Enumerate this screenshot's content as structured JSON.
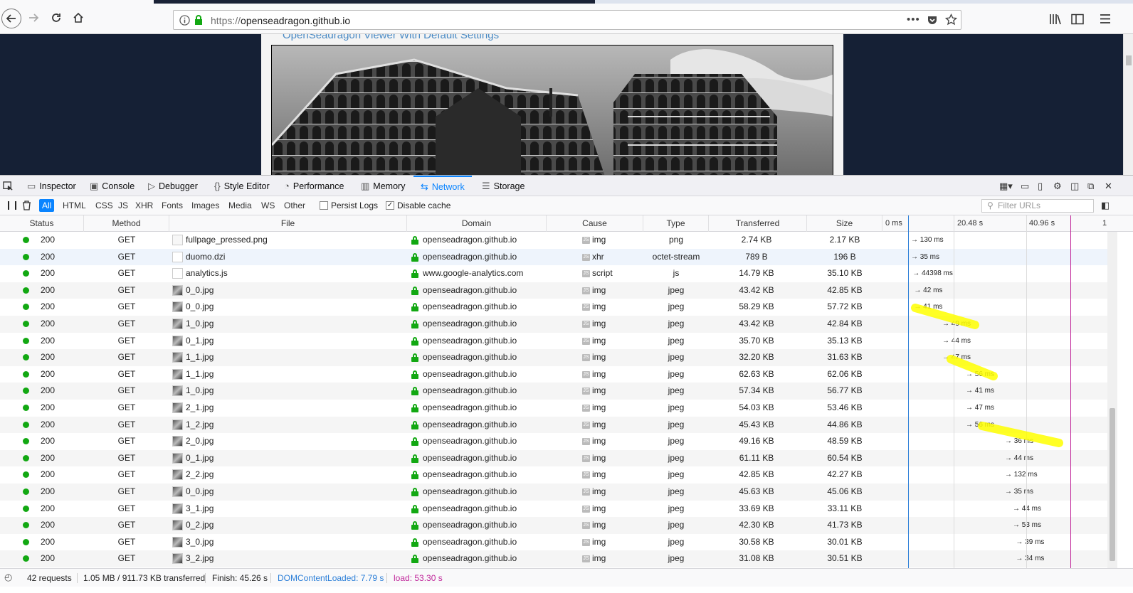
{
  "browser": {
    "url_scheme": "https://",
    "url_host": "openseadragon.github.io"
  },
  "page": {
    "title": "OpenSeadragon Viewer With Default Settings"
  },
  "devtools": {
    "tabs": [
      {
        "label": "Inspector",
        "icon": "inspector-icon"
      },
      {
        "label": "Console",
        "icon": "console-icon"
      },
      {
        "label": "Debugger",
        "icon": "debugger-icon"
      },
      {
        "label": "Style Editor",
        "icon": "style-editor-icon"
      },
      {
        "label": "Performance",
        "icon": "performance-icon"
      },
      {
        "label": "Memory",
        "icon": "memory-icon"
      },
      {
        "label": "Network",
        "icon": "network-icon",
        "active": true
      },
      {
        "label": "Storage",
        "icon": "storage-icon"
      }
    ],
    "filters": [
      "All",
      "HTML",
      "CSS",
      "JS",
      "XHR",
      "Fonts",
      "Images",
      "Media",
      "WS",
      "Other"
    ],
    "active_filter": "All",
    "persist_logs_label": "Persist Logs",
    "persist_logs_checked": false,
    "disable_cache_label": "Disable cache",
    "disable_cache_checked": true,
    "filter_urls_placeholder": "Filter URLs",
    "columns": {
      "status": "Status",
      "method": "Method",
      "file": "File",
      "domain": "Domain",
      "cause": "Cause",
      "type": "Type",
      "transferred": "Transferred",
      "size": "Size"
    },
    "timeline_ticks": [
      "0 ms",
      "20.48 s",
      "40.96 s",
      "1"
    ],
    "requests": [
      {
        "status": "200",
        "method": "GET",
        "file": "fullpage_pressed.png",
        "domain": "openseadragon.github.io",
        "cause": "img",
        "type": "png",
        "transferred": "2.74 KB",
        "size": "2.17 KB",
        "timing": "130 ms",
        "start_fraction": 0.0
      },
      {
        "status": "200",
        "method": "GET",
        "file": "duomo.dzi",
        "domain": "openseadragon.github.io",
        "cause": "xhr",
        "type": "octet-stream",
        "transferred": "789 B",
        "size": "196 B",
        "timing": "35 ms",
        "start_fraction": 0.0
      },
      {
        "status": "200",
        "method": "GET",
        "file": "analytics.js",
        "domain": "www.google-analytics.com",
        "cause": "script",
        "type": "js",
        "transferred": "14.79 KB",
        "size": "35.10 KB",
        "timing": "44398 ms",
        "start_fraction": 0.01
      },
      {
        "status": "200",
        "method": "GET",
        "file": "0_0.jpg",
        "domain": "openseadragon.github.io",
        "cause": "img",
        "type": "jpeg",
        "transferred": "43.42 KB",
        "size": "42.85 KB",
        "timing": "42 ms",
        "start_fraction": 0.02
      },
      {
        "status": "200",
        "method": "GET",
        "file": "0_0.jpg",
        "domain": "openseadragon.github.io",
        "cause": "img",
        "type": "jpeg",
        "transferred": "58.29 KB",
        "size": "57.72 KB",
        "timing": "41 ms",
        "start_fraction": 0.02
      },
      {
        "status": "200",
        "method": "GET",
        "file": "1_0.jpg",
        "domain": "openseadragon.github.io",
        "cause": "img",
        "type": "jpeg",
        "transferred": "43.42 KB",
        "size": "42.84 KB",
        "timing": "49 ms",
        "start_fraction": 0.2
      },
      {
        "status": "200",
        "method": "GET",
        "file": "0_1.jpg",
        "domain": "openseadragon.github.io",
        "cause": "img",
        "type": "jpeg",
        "transferred": "35.70 KB",
        "size": "35.13 KB",
        "timing": "44 ms",
        "start_fraction": 0.2
      },
      {
        "status": "200",
        "method": "GET",
        "file": "1_1.jpg",
        "domain": "openseadragon.github.io",
        "cause": "img",
        "type": "jpeg",
        "transferred": "32.20 KB",
        "size": "31.63 KB",
        "timing": "47 ms",
        "start_fraction": 0.2
      },
      {
        "status": "200",
        "method": "GET",
        "file": "1_1.jpg",
        "domain": "openseadragon.github.io",
        "cause": "img",
        "type": "jpeg",
        "transferred": "62.63 KB",
        "size": "62.06 KB",
        "timing": "56 ms",
        "start_fraction": 0.35
      },
      {
        "status": "200",
        "method": "GET",
        "file": "1_0.jpg",
        "domain": "openseadragon.github.io",
        "cause": "img",
        "type": "jpeg",
        "transferred": "57.34 KB",
        "size": "56.77 KB",
        "timing": "41 ms",
        "start_fraction": 0.35
      },
      {
        "status": "200",
        "method": "GET",
        "file": "2_1.jpg",
        "domain": "openseadragon.github.io",
        "cause": "img",
        "type": "jpeg",
        "transferred": "54.03 KB",
        "size": "53.46 KB",
        "timing": "47 ms",
        "start_fraction": 0.35
      },
      {
        "status": "200",
        "method": "GET",
        "file": "1_2.jpg",
        "domain": "openseadragon.github.io",
        "cause": "img",
        "type": "jpeg",
        "transferred": "45.43 KB",
        "size": "44.86 KB",
        "timing": "56 ms",
        "start_fraction": 0.35
      },
      {
        "status": "200",
        "method": "GET",
        "file": "2_0.jpg",
        "domain": "openseadragon.github.io",
        "cause": "img",
        "type": "jpeg",
        "transferred": "49.16 KB",
        "size": "48.59 KB",
        "timing": "36 ms",
        "start_fraction": 0.6
      },
      {
        "status": "200",
        "method": "GET",
        "file": "0_1.jpg",
        "domain": "openseadragon.github.io",
        "cause": "img",
        "type": "jpeg",
        "transferred": "61.11 KB",
        "size": "60.54 KB",
        "timing": "44 ms",
        "start_fraction": 0.6
      },
      {
        "status": "200",
        "method": "GET",
        "file": "2_2.jpg",
        "domain": "openseadragon.github.io",
        "cause": "img",
        "type": "jpeg",
        "transferred": "42.85 KB",
        "size": "42.27 KB",
        "timing": "132 ms",
        "start_fraction": 0.6
      },
      {
        "status": "200",
        "method": "GET",
        "file": "0_0.jpg",
        "domain": "openseadragon.github.io",
        "cause": "img",
        "type": "jpeg",
        "transferred": "45.63 KB",
        "size": "45.06 KB",
        "timing": "35 ms",
        "start_fraction": 0.6
      },
      {
        "status": "200",
        "method": "GET",
        "file": "3_1.jpg",
        "domain": "openseadragon.github.io",
        "cause": "img",
        "type": "jpeg",
        "transferred": "33.69 KB",
        "size": "33.11 KB",
        "timing": "44 ms",
        "start_fraction": 0.65
      },
      {
        "status": "200",
        "method": "GET",
        "file": "0_2.jpg",
        "domain": "openseadragon.github.io",
        "cause": "img",
        "type": "jpeg",
        "transferred": "42.30 KB",
        "size": "41.73 KB",
        "timing": "53 ms",
        "start_fraction": 0.65
      },
      {
        "status": "200",
        "method": "GET",
        "file": "3_0.jpg",
        "domain": "openseadragon.github.io",
        "cause": "img",
        "type": "jpeg",
        "transferred": "30.58 KB",
        "size": "30.01 KB",
        "timing": "39 ms",
        "start_fraction": 0.67
      },
      {
        "status": "200",
        "method": "GET",
        "file": "3_2.jpg",
        "domain": "openseadragon.github.io",
        "cause": "img",
        "type": "jpeg",
        "transferred": "31.08 KB",
        "size": "30.51 KB",
        "timing": "34 ms",
        "start_fraction": 0.67
      }
    ],
    "status_bar": {
      "requests": "42 requests",
      "transferred": "1.05 MB / 911.73 KB transferred",
      "finish": "Finish: 45.26 s",
      "dom_content_loaded": "DOMContentLoaded: 7.79 s",
      "load": "load: 53.30 s"
    },
    "colors": {
      "accent": "#0a84ff",
      "status_ok": "#12a812",
      "dcl_line": "#2c7fd8",
      "load_line": "#c0269a",
      "highlight": "#ffff00"
    }
  }
}
